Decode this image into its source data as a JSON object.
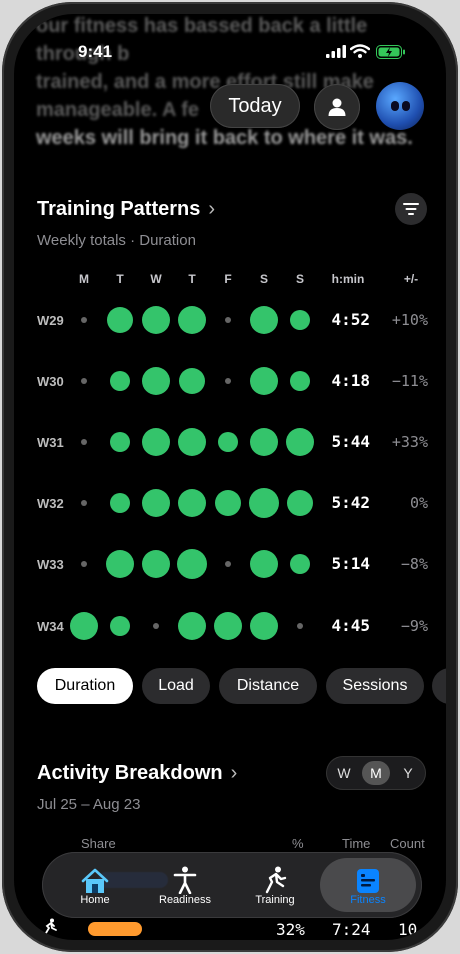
{
  "bg_text": {
    "lines": [
      "our fitness has bassed back a little",
      "through b",
      "trained, and a more effort still make",
      "manageable. A fe",
      "weeks will bring it back to where it was."
    ]
  },
  "status": {
    "time": "9:41"
  },
  "header": {
    "today_label": "Today"
  },
  "training_patterns": {
    "title": "Training Patterns",
    "subtitle": "Weekly totals · Duration",
    "day_headers": [
      "M",
      "T",
      "W",
      "T",
      "F",
      "S",
      "S"
    ],
    "col_hmin": "h:min",
    "col_delta": "+/-",
    "weeks": [
      {
        "label": "W29",
        "dots": [
          0,
          2,
          3,
          3,
          0,
          3,
          1
        ],
        "hmin": "4:52",
        "delta": "+10%"
      },
      {
        "label": "W30",
        "dots": [
          0,
          1,
          3,
          2,
          0,
          3,
          1
        ],
        "hmin": "4:18",
        "delta": "−11%"
      },
      {
        "label": "W31",
        "dots": [
          0,
          1,
          3,
          3,
          1,
          3,
          3
        ],
        "hmin": "5:44",
        "delta": "+33%"
      },
      {
        "label": "W32",
        "dots": [
          0,
          1,
          3,
          3,
          2,
          4,
          2
        ],
        "hmin": "5:42",
        "delta": "0%"
      },
      {
        "label": "W33",
        "dots": [
          0,
          3,
          3,
          4,
          0,
          3,
          1
        ],
        "hmin": "5:14",
        "delta": "−8%"
      },
      {
        "label": "W34",
        "dots": [
          3,
          1,
          0,
          3,
          3,
          3,
          0
        ],
        "hmin": "4:45",
        "delta": "−9%"
      }
    ],
    "dot_color": "#34c46b"
  },
  "metric_chips": [
    "Duration",
    "Load",
    "Distance",
    "Sessions"
  ],
  "activity_breakdown": {
    "title": "Activity Breakdown",
    "date_range": "Jul 25 – Aug 23",
    "segments": [
      "W",
      "M",
      "Y"
    ],
    "selected_segment": "M",
    "columns": {
      "share": "Share",
      "pct": "%",
      "time": "Time",
      "count": "Count"
    },
    "visible_row": {
      "pct": "32%",
      "time": "7:24",
      "count": "10"
    }
  },
  "tabbar": {
    "items": [
      {
        "label": "Home",
        "icon": "house-icon"
      },
      {
        "label": "Readiness",
        "icon": "figure-icon"
      },
      {
        "label": "Training",
        "icon": "running-icon"
      },
      {
        "label": "Fitness",
        "icon": "fitness-icon"
      }
    ],
    "selected": "Fitness"
  },
  "colors": {
    "accent": "#0a84ff",
    "green": "#34c46b",
    "orange": "#ff9a2e",
    "blue": "#1560ff"
  }
}
